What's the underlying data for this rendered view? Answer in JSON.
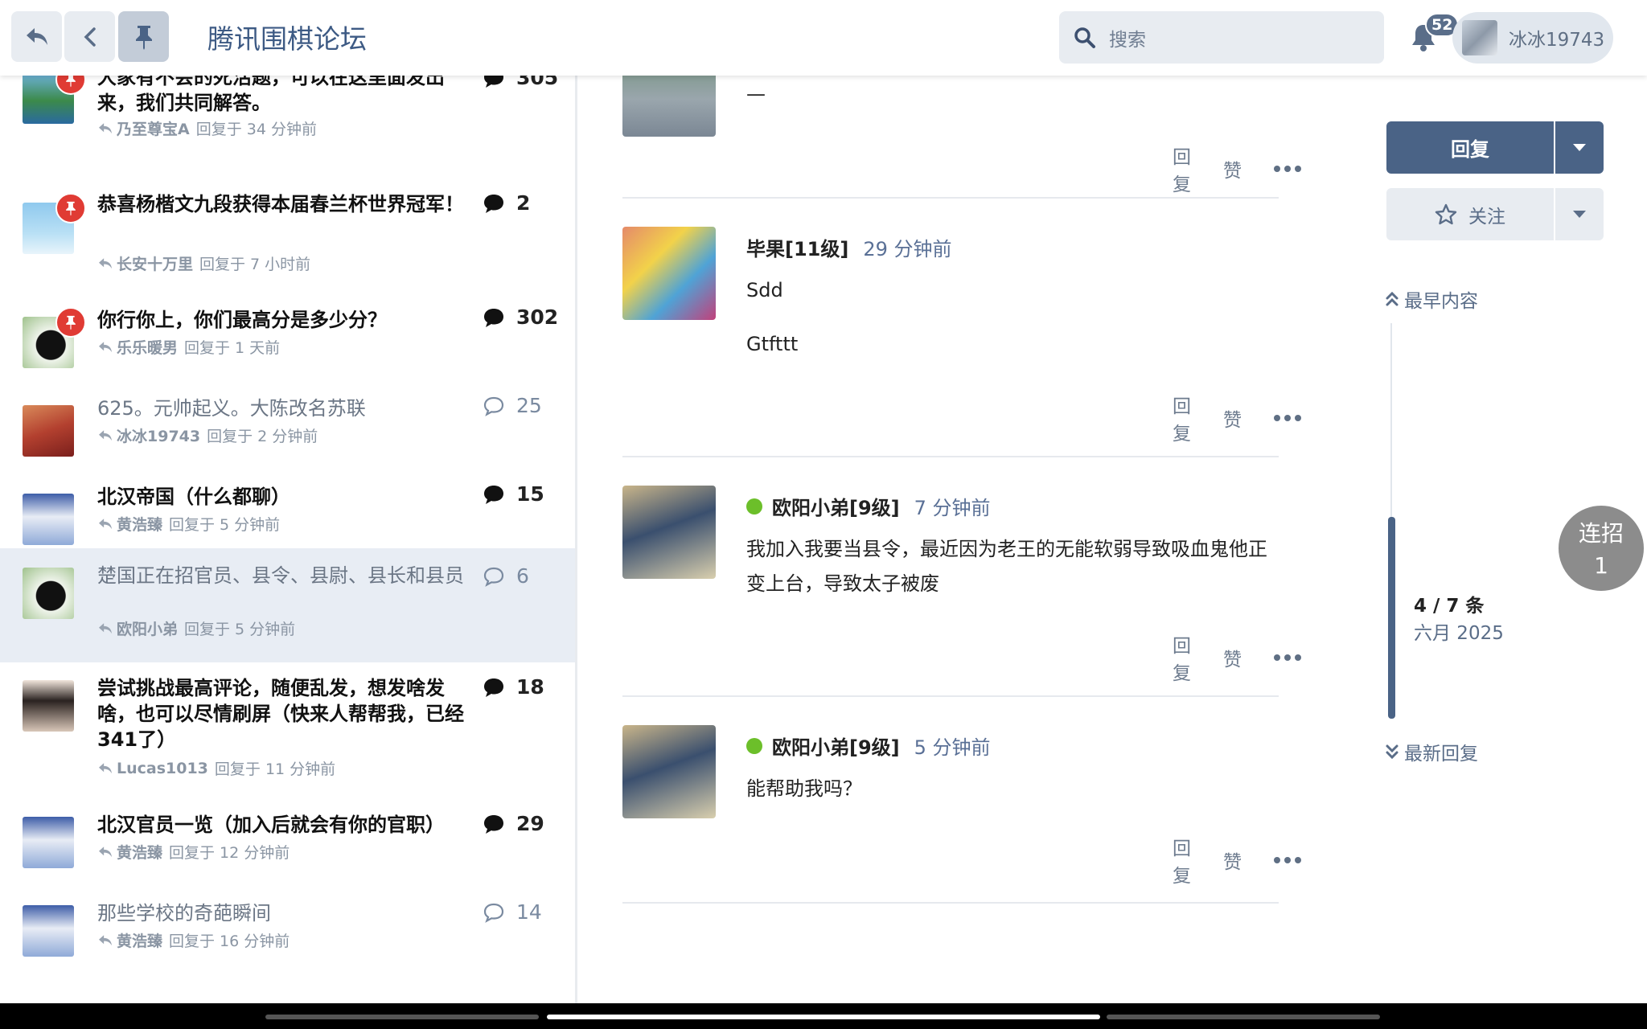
{
  "header": {
    "site_title": "腾讯围棋论坛",
    "search_placeholder": "搜索",
    "notification_count": "52",
    "username": "冰冰19743"
  },
  "topics": [
    {
      "title": "大家有不会的死活题，可以在这里面发出来，我们共同解答。",
      "user": "乃至尊宝A",
      "time": "回复于 34 分钟前",
      "replies": "305",
      "pinned": true,
      "read": false
    },
    {
      "title": "恭喜杨楷文九段获得本届春兰杯世界冠军！",
      "user": "长安十万里",
      "time": "回复于 7 小时前",
      "replies": "2",
      "pinned": true,
      "read": false
    },
    {
      "title": "你行你上，你们最高分是多少分？",
      "user": "乐乐暖男",
      "time": "回复于 1 天前",
      "replies": "302",
      "pinned": true,
      "read": false
    },
    {
      "title": "625。元帅起义。大陈改名苏联",
      "user": "冰冰19743",
      "time": "回复于 2 分钟前",
      "replies": "25",
      "pinned": false,
      "read": true
    },
    {
      "title": "北汉帝国（什么都聊）",
      "user": "黄浩臻",
      "time": "回复于 5 分钟前",
      "replies": "15",
      "pinned": false,
      "read": false
    },
    {
      "title": "楚国正在招官员、县令、县尉、县长和县员",
      "user": "欧阳小弟",
      "time": "回复于 5 分钟前",
      "replies": "6",
      "pinned": false,
      "read": true
    },
    {
      "title": "尝试挑战最高评论，随便乱发，想发啥发啥，也可以尽情刷屏（快来人帮帮我，已经341了）",
      "user": "Lucas1013",
      "time": "回复于 11 分钟前",
      "replies": "18",
      "pinned": false,
      "read": false
    },
    {
      "title": "北汉官员一览（加入后就会有你的官职）",
      "user": "黄浩臻",
      "time": "回复于 12 分钟前",
      "replies": "29",
      "pinned": false,
      "read": false
    },
    {
      "title": "那些学校的奇葩瞬间",
      "user": "黄浩臻",
      "time": "回复于 16 分钟前",
      "replies": "14",
      "pinned": false,
      "read": true
    }
  ],
  "posts": [
    {
      "author": "",
      "time": "",
      "online": false,
      "body": [
        "—"
      ]
    },
    {
      "author": "毕果[11级]",
      "time": "29 分钟前",
      "online": false,
      "body": [
        "Sdd",
        "Gtfttt"
      ]
    },
    {
      "author": "欧阳小弟[9级]",
      "time": "7 分钟前",
      "online": true,
      "body": [
        "我加入我要当县令，最近因为老王的无能软弱导致吸血鬼他正变上台，导致太子被废"
      ]
    },
    {
      "author": "欧阳小弟[9级]",
      "time": "5 分钟前",
      "online": true,
      "body": [
        "能帮助我吗？"
      ]
    }
  ],
  "post_actions": {
    "reply": "回复",
    "like": "赞"
  },
  "sidebar": {
    "reply_button": "回复",
    "follow_button": "关注",
    "earliest": "最早内容",
    "position": "4 / 7 条",
    "date": "六月 2025",
    "latest": "最新回复"
  },
  "float_button": {
    "line1": "连招",
    "line2": "1"
  },
  "colors": {
    "accent": "#4a6386",
    "pin": "#e03b34",
    "online": "#6cbf2a",
    "selected_row": "#e8edf4"
  }
}
